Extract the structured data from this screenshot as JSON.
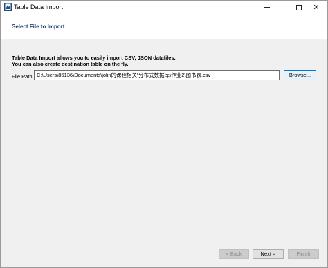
{
  "window": {
    "title": "Table Data Import",
    "controls": {
      "minimize": "minimize",
      "maximize": "maximize",
      "close": "✕"
    }
  },
  "header": {
    "title": "Select File to Import"
  },
  "main": {
    "description_line1": "Table Data Import allows you to easily import CSV, JSON datafiles.",
    "description_line2": "You can also create destination table on the fly.",
    "file_path_label": "File Path:",
    "file_path_value": "C:\\Users\\86136\\Documents\\jolin的课程相关\\分布式数据库\\作业2\\图书表.csv",
    "browse_label": "Browse..."
  },
  "footer": {
    "back_label": "< Back",
    "next_label": "Next >",
    "finish_label": "Finish"
  },
  "colors": {
    "header_title": "#1f3f7a",
    "content_bg": "#f0f0f0",
    "accent": "#0078d7"
  }
}
